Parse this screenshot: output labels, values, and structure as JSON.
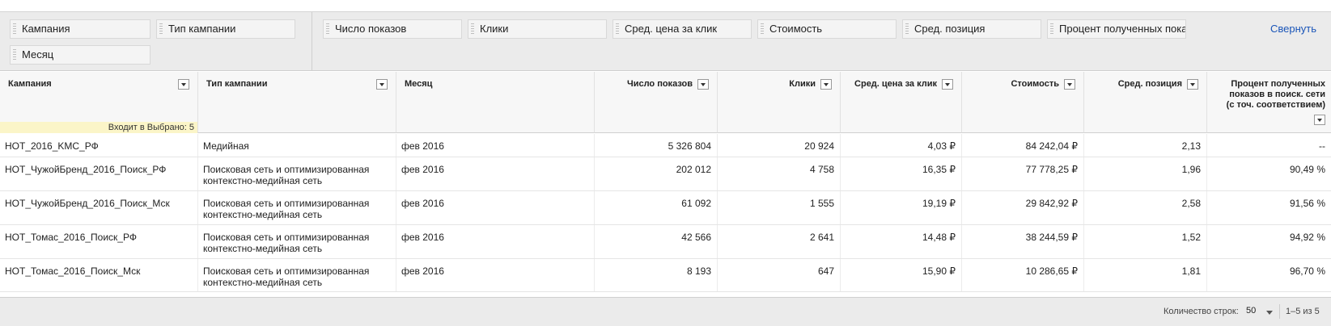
{
  "pivot": {
    "row_chips": [
      "Кампания",
      "Тип кампании",
      "Месяц"
    ],
    "metric_chips": [
      "Число показов",
      "Клики",
      "Сред. цена за клик",
      "Стоимость",
      "Сред. позиция",
      "Процент полученных пока"
    ],
    "collapse_label": "Свернуть"
  },
  "table": {
    "headers": [
      "Кампания",
      "Тип кампании",
      "Месяц",
      "Число показов",
      "Клики",
      "Сред. цена за клик",
      "Стоимость",
      "Сред. позиция",
      "Процент полученных\nпоказов в поиск. сети\n(с точ. соответствием)"
    ],
    "included_label": "Входит в Выбрано: 5",
    "rows": [
      [
        "HOT_2016_KMC_РФ",
        "Медийная",
        "фев 2016",
        "5 326 804",
        "20 924",
        "4,03 ₽",
        "84 242,04 ₽",
        "2,13",
        "--"
      ],
      [
        "HOT_ЧужойБренд_2016_Поиск_РФ",
        "Поисковая сеть и оптимизированная\nконтекстно-медийная сеть",
        "фев 2016",
        "202 012",
        "4 758",
        "16,35 ₽",
        "77 778,25 ₽",
        "1,96",
        "90,49 %"
      ],
      [
        "HOT_ЧужойБренд_2016_Поиск_Мск",
        "Поисковая сеть и оптимизированная\nконтекстно-медийная сеть",
        "фев 2016",
        "61 092",
        "1 555",
        "19,19 ₽",
        "29 842,92 ₽",
        "2,58",
        "91,56 %"
      ],
      [
        "HOT_Томас_2016_Поиск_РФ",
        "Поисковая сеть и оптимизированная\nконтекстно-медийная сеть",
        "фев 2016",
        "42 566",
        "2 641",
        "14,48 ₽",
        "38 244,59 ₽",
        "1,52",
        "94,92 %"
      ],
      [
        "HOT_Томас_2016_Поиск_Мск",
        "Поисковая сеть и оптимизированная\nконтекстно-медийная сеть",
        "фев 2016",
        "8 193",
        "647",
        "15,90 ₽",
        "10 286,65 ₽",
        "1,81",
        "96,70 %"
      ]
    ]
  },
  "footer": {
    "rows_label": "Количество строк:",
    "rows_value": "50",
    "pager": "1–5 из 5"
  },
  "colors": {
    "link": "#1a55b8",
    "highlight": "#fbf5c8"
  }
}
